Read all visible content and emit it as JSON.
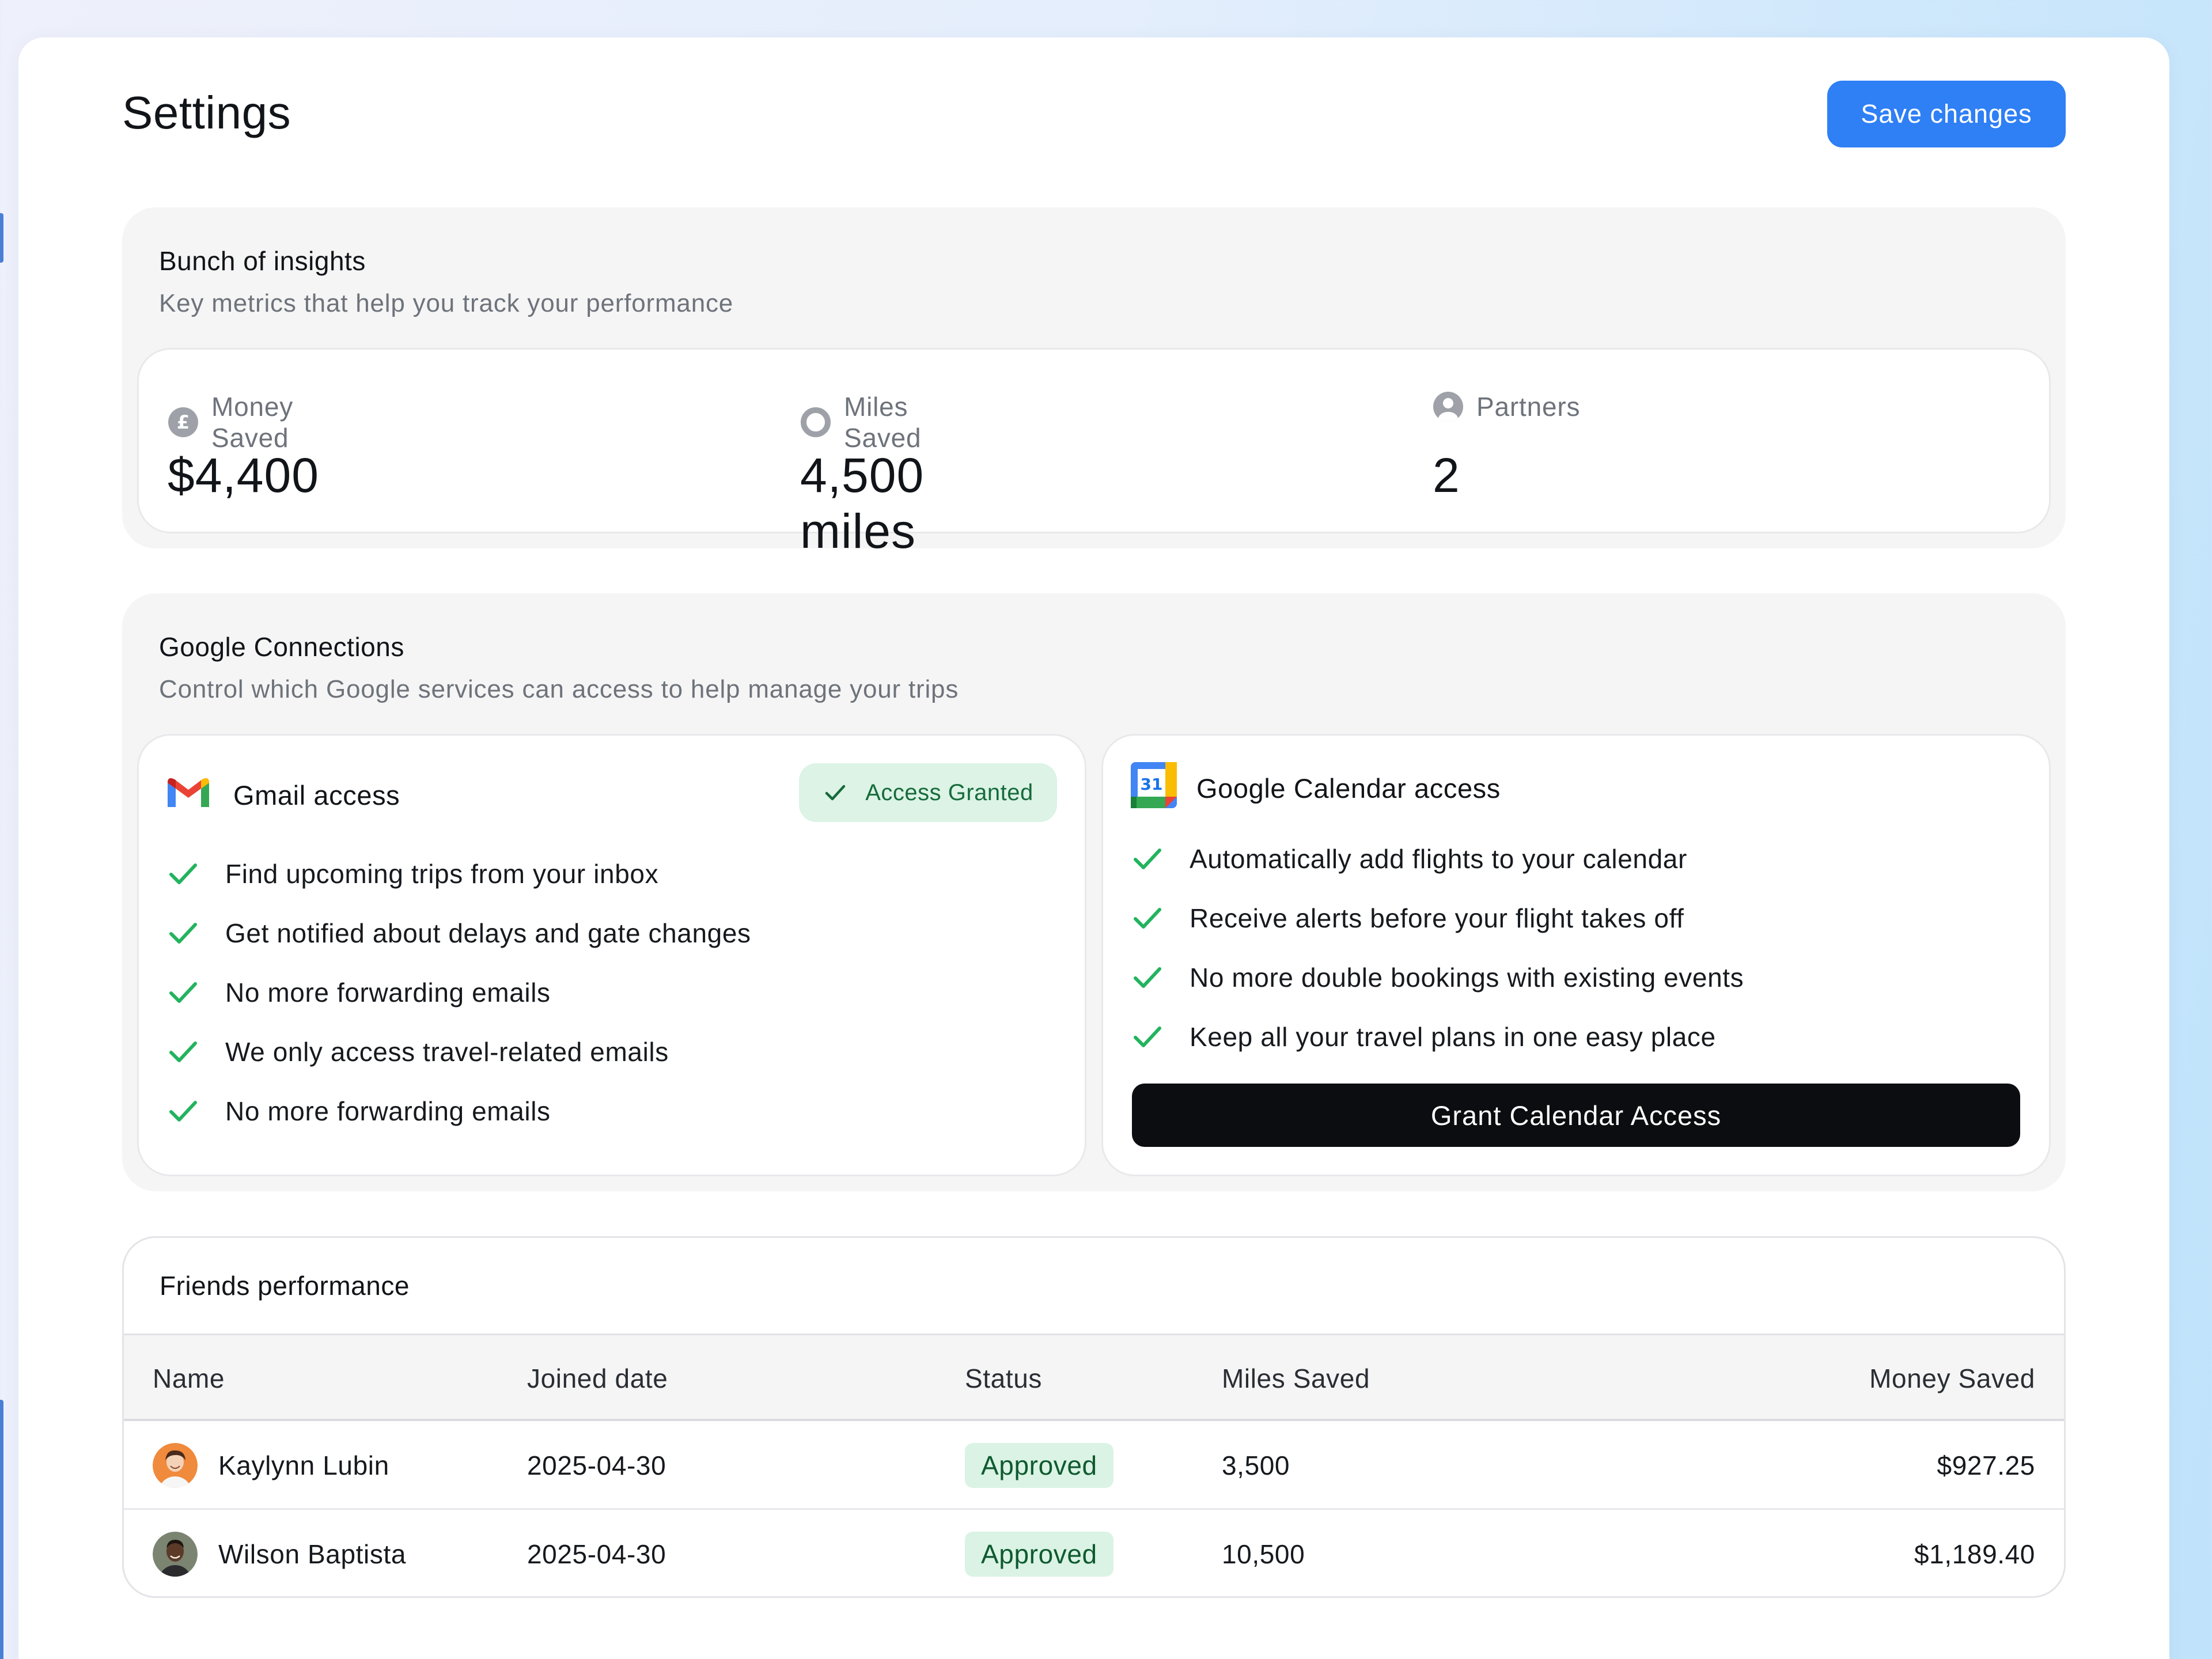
{
  "page": {
    "title": "Settings",
    "save_label": "Save changes"
  },
  "colors": {
    "primary": "#2f7ff5",
    "success_bg": "#daf3e4",
    "success_fg": "#0f5a30",
    "check": "#22b35e",
    "dark_button": "#0c0d10"
  },
  "insights": {
    "title": "Bunch of insights",
    "subtitle": "Key metrics that help you track your performance",
    "metrics": [
      {
        "icon": "pound-coin-icon",
        "label": "Money Saved",
        "value": "$4,400"
      },
      {
        "icon": "ring-icon",
        "label": "Miles Saved",
        "value": "4,500 miles"
      },
      {
        "icon": "user-circle-icon",
        "label": "Partners",
        "value": "2"
      }
    ]
  },
  "google": {
    "title": "Google Connections",
    "subtitle": "Control which Google services can access to help manage your trips",
    "gmail": {
      "icon": "gmail-icon",
      "title": "Gmail access",
      "badge": "Access Granted",
      "features": [
        "Find upcoming trips from your inbox",
        "Get notified about delays and gate changes",
        "No more forwarding emails",
        "We only access travel-related emails",
        "No more forwarding emails"
      ]
    },
    "calendar": {
      "icon": "google-calendar-icon",
      "icon_text": "31",
      "title": "Google Calendar access",
      "features": [
        "Automatically add flights to your calendar",
        "Receive alerts before your flight takes off",
        "No more double bookings with existing events",
        "Keep all your travel plans in one easy place"
      ],
      "button_label": "Grant Calendar Access"
    }
  },
  "friends": {
    "title": "Friends performance",
    "columns": {
      "name": "Name",
      "joined": "Joined date",
      "status": "Status",
      "miles": "Miles Saved",
      "money": "Money Saved"
    },
    "rows": [
      {
        "name": "Kaylynn Lubin",
        "joined": "2025-04-30",
        "status": "Approved",
        "miles": "3,500",
        "money": "$927.25"
      },
      {
        "name": "Wilson Baptista",
        "joined": "2025-04-30",
        "status": "Approved",
        "miles": "10,500",
        "money": "$1,189.40"
      }
    ]
  }
}
